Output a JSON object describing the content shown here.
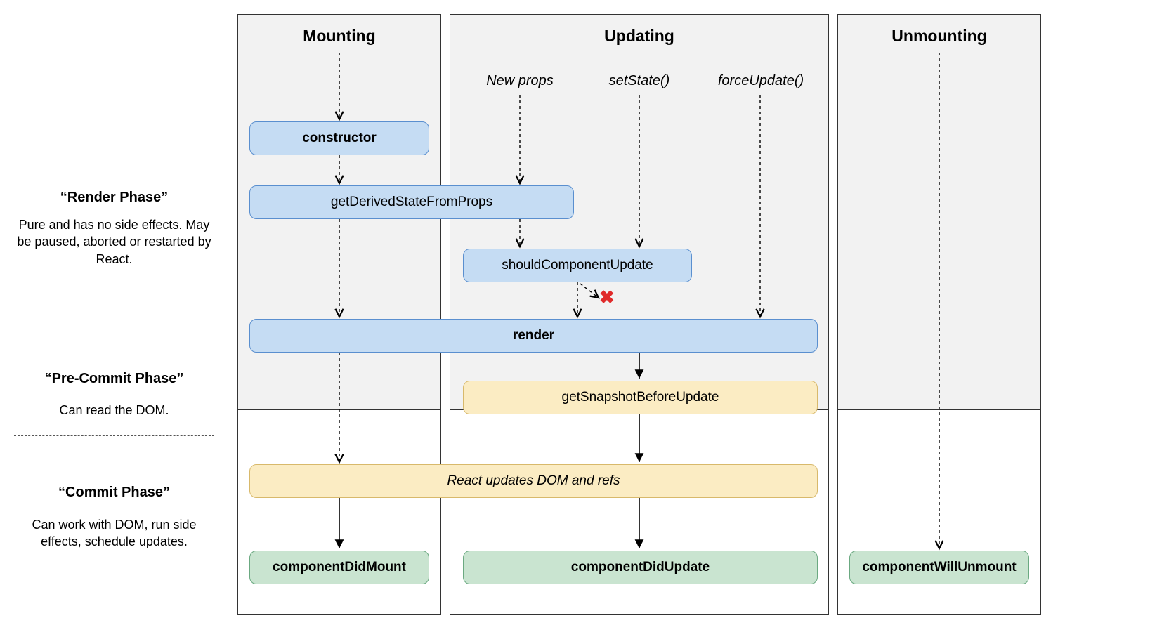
{
  "columns": {
    "mounting": "Mounting",
    "updating": "Updating",
    "unmounting": "Unmounting"
  },
  "triggers": {
    "newProps": "New props",
    "setState": "setState()",
    "forceUpdate": "forceUpdate()"
  },
  "boxes": {
    "constructor": "constructor",
    "getDerivedStateFromProps": "getDerivedStateFromProps",
    "shouldComponentUpdate": "shouldComponentUpdate",
    "render": "render",
    "getSnapshotBeforeUpdate": "getSnapshotBeforeUpdate",
    "reactUpdatesDom": "React updates DOM and refs",
    "componentDidMount": "componentDidMount",
    "componentDidUpdate": "componentDidUpdate",
    "componentWillUnmount": "componentWillUnmount"
  },
  "phases": {
    "render": {
      "title": "“Render Phase”",
      "desc": "Pure and has no side effects. May be paused, aborted or restarted by React."
    },
    "preCommit": {
      "title": "“Pre-Commit Phase”",
      "desc": "Can read the DOM."
    },
    "commit": {
      "title": "“Commit Phase”",
      "desc": "Can work with DOM, run side effects, schedule updates."
    }
  },
  "cross": "✖"
}
